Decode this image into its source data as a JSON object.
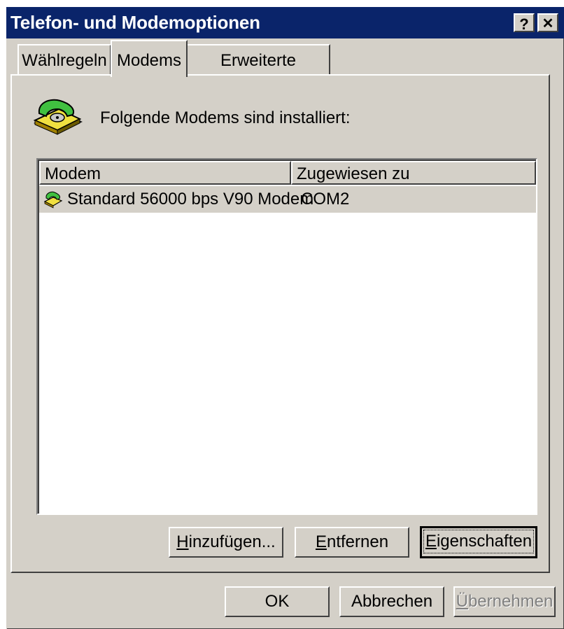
{
  "window": {
    "title": "Telefon- und Modemoptionen",
    "help_button": "?",
    "close_button": "✕"
  },
  "tabs": [
    {
      "label": "Wählregeln",
      "active": false
    },
    {
      "label": "Modems",
      "active": true
    },
    {
      "label": "Erweiterte Optionen",
      "active": false
    }
  ],
  "modems_tab": {
    "header_icon": "telephone-modem-icon",
    "header_text": "Folgende Modems sind installiert:",
    "list": {
      "columns": [
        "Modem",
        "Zugewiesen zu"
      ],
      "rows": [
        {
          "icon": "modem-icon",
          "modem": "Standard 56000 bps V90 Modem",
          "port": "COM2"
        }
      ]
    },
    "buttons": {
      "add": {
        "pre": "",
        "key": "H",
        "post": "inzufügen..."
      },
      "remove": {
        "pre": "",
        "key": "E",
        "post": "ntfernen"
      },
      "properties": {
        "pre": "",
        "key": "E",
        "post": "igenschaften"
      }
    }
  },
  "dialog_buttons": {
    "ok": "OK",
    "cancel": "Abbrechen",
    "apply": {
      "pre": "",
      "key": "Ü",
      "post": "bernehmen",
      "disabled": true
    }
  },
  "colors": {
    "titlebar": "#0a246a",
    "face": "#d4d0c8"
  }
}
